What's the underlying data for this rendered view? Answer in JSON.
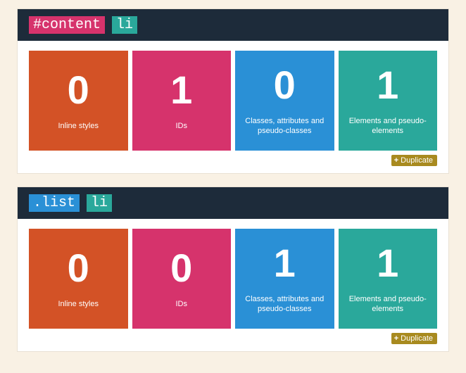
{
  "labels": {
    "inline": "Inline styles",
    "ids": "IDs",
    "classes": "Classes, attributes and pseudo-classes",
    "elements": "Elements and pseudo-elements",
    "duplicate": "Duplicate",
    "plus": "+"
  },
  "cards": [
    {
      "tokens": [
        {
          "text": "#content",
          "kind": "id"
        },
        {
          "text": "li",
          "kind": "el"
        }
      ],
      "specificity": {
        "inline": "0",
        "ids": "1",
        "classes": "0",
        "elements": "1"
      }
    },
    {
      "tokens": [
        {
          "text": ".list",
          "kind": "cls"
        },
        {
          "text": "li",
          "kind": "el"
        }
      ],
      "specificity": {
        "inline": "0",
        "ids": "0",
        "classes": "1",
        "elements": "1"
      }
    }
  ]
}
